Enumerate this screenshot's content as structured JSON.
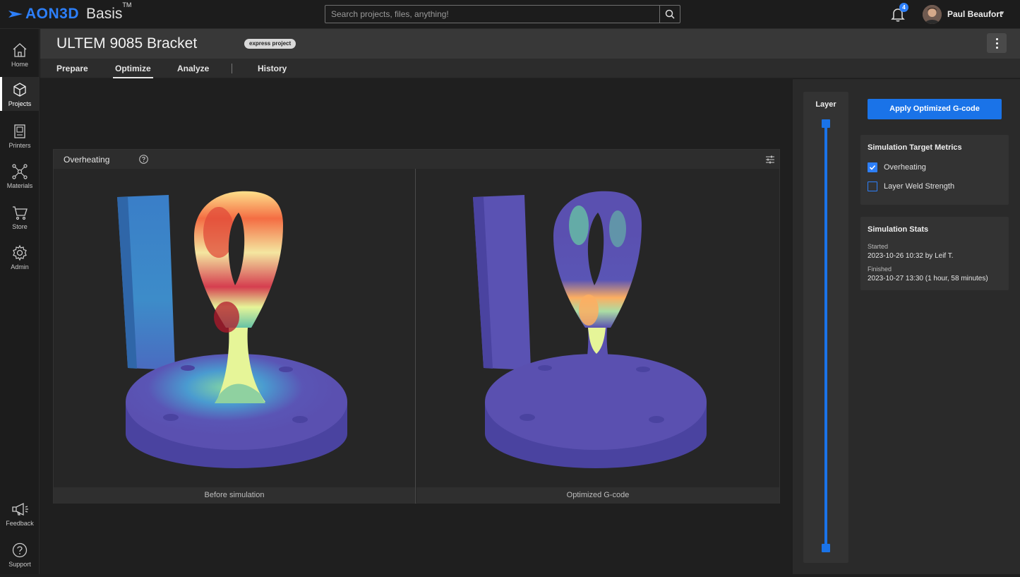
{
  "app": {
    "brand": "AON3D",
    "product": "Basis",
    "tm": "TM"
  },
  "search": {
    "placeholder": "Search projects, files, anything!"
  },
  "notifications": {
    "count": "4"
  },
  "user": {
    "name": "Paul Beaufort"
  },
  "sidebar": {
    "items": [
      {
        "label": "Home",
        "icon": "home-icon"
      },
      {
        "label": "Projects",
        "icon": "cube-icon",
        "active": true
      },
      {
        "label": "Printers",
        "icon": "printer-icon"
      },
      {
        "label": "Materials",
        "icon": "molecule-icon"
      },
      {
        "label": "Store",
        "icon": "cart-icon"
      },
      {
        "label": "Admin",
        "icon": "gear-icon"
      }
    ],
    "bottom": [
      {
        "label": "Feedback",
        "icon": "megaphone-icon"
      },
      {
        "label": "Support",
        "icon": "question-icon"
      }
    ]
  },
  "project": {
    "title": "ULTEM 9085 Bracket",
    "badge": "express project"
  },
  "tabs": {
    "prepare": "Prepare",
    "optimize": "Optimize",
    "analyze": "Analyze",
    "history": "History",
    "active": "Optimize"
  },
  "viewer": {
    "title": "Overheating",
    "left_caption": "Before simulation",
    "right_caption": "Optimized G-code"
  },
  "layer": {
    "title": "Layer"
  },
  "actions": {
    "apply": "Apply Optimized G-code"
  },
  "metrics": {
    "title": "Simulation Target Metrics",
    "options": [
      {
        "label": "Overheating",
        "checked": true
      },
      {
        "label": "Layer Weld Strength",
        "checked": false
      }
    ]
  },
  "stats": {
    "title": "Simulation Stats",
    "started_label": "Started",
    "started_value": "2023-10-26 10:32 by Leif T.",
    "finished_label": "Finished",
    "finished_value": "2023-10-27 13:30 (1 hour, 58 minutes)"
  },
  "colors": {
    "accent": "#1a73e8",
    "hot": "#d7301f",
    "cool": "#5a50b0"
  }
}
